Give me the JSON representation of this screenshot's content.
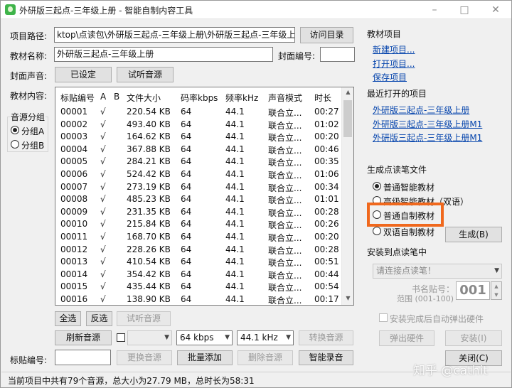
{
  "window": {
    "title": "外研版三起点-三年级上册 - 智能自制内容工具",
    "minimize": "–",
    "maximize": "□",
    "close": "✕"
  },
  "project": {
    "path_label": "项目路径:",
    "path_value": "ktop\\点读包\\外研版三起点-三年级上册\\外研版三起点-三年级上册\\",
    "visit_button": "访问目录",
    "name_label": "教材名称:",
    "name_value": "外研版三起点-三年级上册",
    "cover_no_label": "封面编号:",
    "cover_no_value": "",
    "cover_audio_label": "封面声音:",
    "cover_audio_button": "已设定",
    "listen_button": "试听音源",
    "content_label": "教材内容:"
  },
  "audio_group": {
    "title": "音源分组",
    "options": [
      "分组A",
      "分组B"
    ],
    "selected": 0
  },
  "table": {
    "columns": [
      "标贴编号",
      "A",
      "B",
      "文件大小",
      "码率kbps",
      "频率kHz",
      "声音模式",
      "时长"
    ],
    "rows": [
      [
        "00001",
        "√",
        "",
        "220.54 KB",
        "64",
        "44.1",
        "联合立...",
        "00:27"
      ],
      [
        "00002",
        "√",
        "",
        "493.40 KB",
        "64",
        "44.1",
        "联合立...",
        "01:02"
      ],
      [
        "00003",
        "√",
        "",
        "164.62 KB",
        "64",
        "44.1",
        "联合立...",
        "00:20"
      ],
      [
        "00004",
        "√",
        "",
        "367.88 KB",
        "64",
        "44.1",
        "联合立...",
        "00:46"
      ],
      [
        "00005",
        "√",
        "",
        "284.21 KB",
        "64",
        "44.1",
        "联合立...",
        "00:35"
      ],
      [
        "00006",
        "√",
        "",
        "524.42 KB",
        "64",
        "44.1",
        "联合立...",
        "01:06"
      ],
      [
        "00007",
        "√",
        "",
        "273.19 KB",
        "64",
        "44.1",
        "联合立...",
        "00:34"
      ],
      [
        "00008",
        "√",
        "",
        "485.23 KB",
        "64",
        "44.1",
        "联合立...",
        "01:01"
      ],
      [
        "00009",
        "√",
        "",
        "231.35 KB",
        "64",
        "44.1",
        "联合立...",
        "00:28"
      ],
      [
        "00010",
        "√",
        "",
        "215.84 KB",
        "64",
        "44.1",
        "联合立...",
        "00:26"
      ],
      [
        "00011",
        "√",
        "",
        "168.70 KB",
        "64",
        "44.1",
        "联合立...",
        "00:20"
      ],
      [
        "00012",
        "√",
        "",
        "228.26 KB",
        "64",
        "44.1",
        "联合立...",
        "00:28"
      ],
      [
        "00013",
        "√",
        "",
        "410.54 KB",
        "64",
        "44.1",
        "联合立...",
        "00:51"
      ],
      [
        "00014",
        "√",
        "",
        "354.42 KB",
        "64",
        "44.1",
        "联合立...",
        "00:44"
      ],
      [
        "00015",
        "√",
        "",
        "435.44 KB",
        "64",
        "44.1",
        "联合立...",
        "00:54"
      ],
      [
        "00016",
        "√",
        "",
        "138.90 KB",
        "64",
        "44.1",
        "联合立...",
        "00:17"
      ]
    ]
  },
  "bottom": {
    "select_all": "全选",
    "invert": "反选",
    "listen": "试听音源",
    "refresh": "刷新音源",
    "format_value": "",
    "bitrate_value": "64 kbps",
    "freq_value": "44.1 kHz",
    "convert": "转换音源",
    "label_no": "标贴编号:",
    "replace": "更换音源",
    "batch_add": "批量添加",
    "delete": "删除音源",
    "smart_record": "智能录音"
  },
  "sidebar": {
    "project_title": "教材项目",
    "new_project": "新建项目...",
    "open_project": "打开项目...",
    "save_project": "保存项目",
    "recent_title": "最近打开的项目",
    "recent": [
      "外研版三起点-三年级上册",
      "外研版三起点-三年级上册M1",
      "外研版三起点-三年级上册M1"
    ],
    "generate_title": "生成点读笔文件",
    "generate_options": [
      "普通智能教材",
      "高级智能教材（双语）",
      "普通自制教材",
      "双语自制教材"
    ],
    "generate_selected": 0,
    "generate_button": "生成(B)",
    "install_title": "安装到点读笔中",
    "pen_select": "请连接点读笔！",
    "book_no_label": "书名贴号：",
    "book_no_range": "范围 (001-100)",
    "book_no_value": "001",
    "auto_eject_label": "安装完成后自动弹出硬件",
    "eject_button": "弹出硬件",
    "install_button": "安装(I)",
    "close_button": "关闭(C)"
  },
  "status_text": "当前项目中共有79个音源，总大小为27.79 MB，总时长为58:31",
  "watermark": "知乎 @cathit"
}
